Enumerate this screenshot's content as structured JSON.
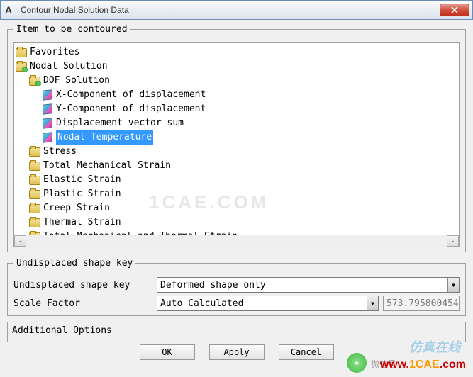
{
  "window": {
    "title": "Contour Nodal Solution Data",
    "app_icon_letter": "A"
  },
  "groupbox": {
    "item_legend": "Item to be contoured",
    "undisplaced_legend": "Undisplaced shape key",
    "additional_legend": "Additional Options"
  },
  "tree": {
    "favorites": "Favorites",
    "nodal_solution": "Nodal Solution",
    "dof_solution": "DOF Solution",
    "x_disp": "X-Component of displacement",
    "y_disp": "Y-Component of displacement",
    "disp_vec_sum": "Displacement vector sum",
    "nodal_temp": "Nodal Temperature",
    "stress": "Stress",
    "total_mech_strain": "Total Mechanical Strain",
    "elastic_strain": "Elastic Strain",
    "plastic_strain": "Plastic Strain",
    "creep_strain": "Creep Strain",
    "thermal_strain": "Thermal Strain",
    "total_mech_thermal_strain": "Total Mechanical and Thermal Strain"
  },
  "form": {
    "undisplaced_label": "Undisplaced shape key",
    "undisplaced_value": "Deformed shape only",
    "scale_label": "Scale Factor",
    "scale_value": "Auto Calculated",
    "scale_number": "573.795800454"
  },
  "buttons": {
    "ok": "OK",
    "apply": "Apply",
    "cancel": "Cancel"
  },
  "watermarks": {
    "brand_cn": "仿真在线",
    "brand_en": "www.1CAE.com",
    "center": "1CAE.COM",
    "wechat_label": "微信号"
  }
}
